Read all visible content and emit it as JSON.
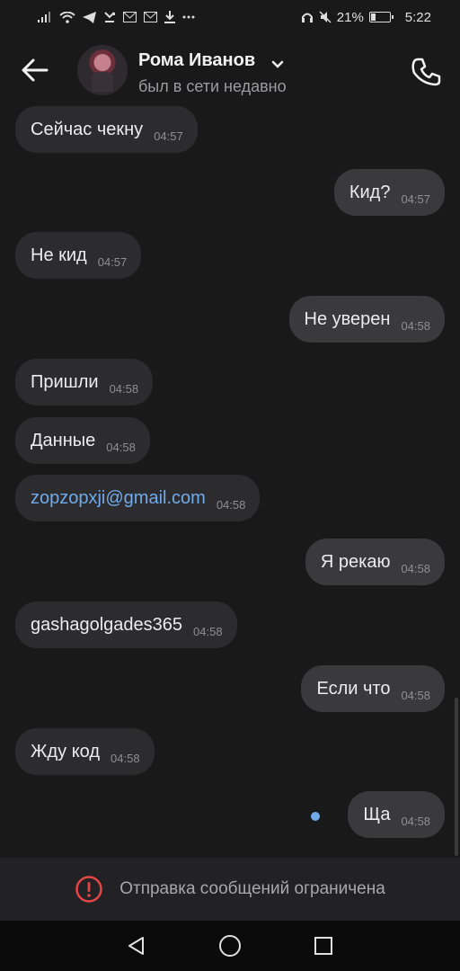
{
  "status_bar": {
    "battery": "21%",
    "time": "5:22",
    "icons": [
      "signal-icon",
      "wifi-icon",
      "telegram-icon",
      "missed-call-icon",
      "mail-icon",
      "mail-icon",
      "download-icon",
      "more-icon",
      "headset-icon",
      "mute-icon",
      "battery-icon"
    ]
  },
  "header": {
    "back_icon": "arrow-left-icon",
    "name": "Рома Иванов",
    "status": "был в сети недавно",
    "call_icon": "phone-icon"
  },
  "messages": [
    {
      "dir": "in",
      "text": "Сейчас чекну",
      "time": "04:57"
    },
    {
      "dir": "out",
      "text": "Кид?",
      "time": "04:57"
    },
    {
      "dir": "in",
      "text": "Не кид",
      "time": "04:57"
    },
    {
      "dir": "out",
      "text": "Не уверен",
      "time": "04:58"
    },
    {
      "dir": "in",
      "text": "Пришли",
      "time": "04:58"
    },
    {
      "dir": "in",
      "text": "Данные",
      "time": "04:58"
    },
    {
      "dir": "in",
      "text": "zopzopxji@gmail.com",
      "time": "04:58",
      "link": true
    },
    {
      "dir": "out",
      "text": "Я рекаю",
      "time": "04:58"
    },
    {
      "dir": "in",
      "text": "gashagolgades365",
      "time": "04:58"
    },
    {
      "dir": "out",
      "text": "Если что",
      "time": "04:58"
    },
    {
      "dir": "in",
      "text": "Жду код",
      "time": "04:58"
    },
    {
      "dir": "out",
      "text": "Ща",
      "time": "04:58"
    }
  ],
  "restriction": {
    "icon": "alert-circle-icon",
    "text": "Отправка сообщений ограничена",
    "color": "#e64646"
  },
  "nav": {
    "back": "nav-back-icon",
    "home": "nav-home-icon",
    "recents": "nav-recents-icon"
  },
  "colors": {
    "background": "#19191a",
    "bubble_in": "#2c2c2e",
    "bubble_out": "#3a3a3c",
    "link": "#71aaeb"
  }
}
